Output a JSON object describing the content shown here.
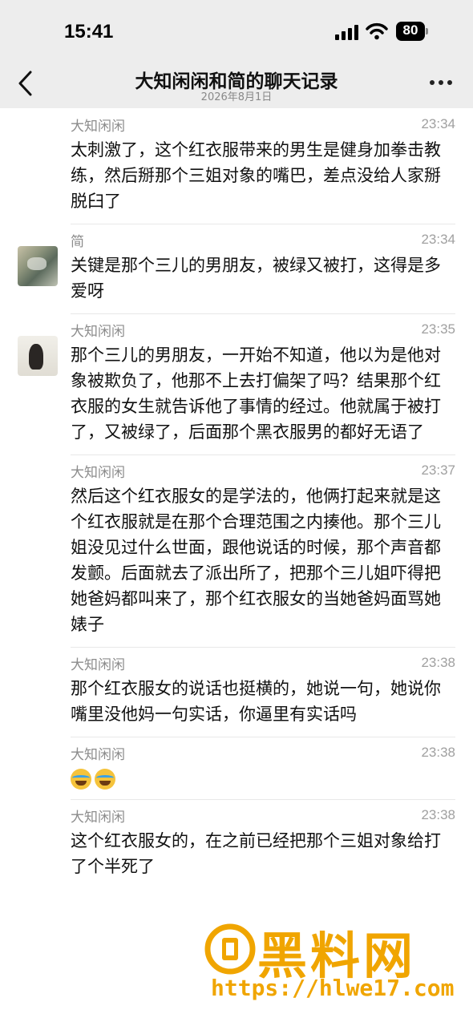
{
  "status_bar": {
    "time": "15:41",
    "battery": "80"
  },
  "nav": {
    "title": "大知闲闲和简的聊天记录",
    "date": "2026年8月1日"
  },
  "messages": [
    {
      "sender": "大知闲闲",
      "time": "23:34",
      "text": "太刺激了，这个红衣服带来的男生是健身加拳击教练，然后掰那个三姐对象的嘴巴，差点没给人家掰脱臼了"
    },
    {
      "sender": "简",
      "time": "23:34",
      "text": "关键是那个三儿的男朋友，被绿又被打，这得是多爱呀"
    },
    {
      "sender": "大知闲闲",
      "time": "23:35",
      "text": "那个三儿的男朋友，一开始不知道，他以为是他对象被欺负了，他那不上去打偏架了吗？结果那个红衣服的女生就告诉他了事情的经过。他就属于被打了，又被绿了，后面那个黑衣服男的都好无语了"
    },
    {
      "sender": "大知闲闲",
      "time": "23:37",
      "text": "然后这个红衣服女的是学法的，他俩打起来就是这个红衣服就是在那个合理范围之内揍他。那个三儿姐没见过什么世面，跟他说话的时候，那个声音都发颤。后面就去了派出所了，把那个三儿姐吓得把她爸妈都叫来了，那个红衣服女的当她爸妈面骂她婊子"
    },
    {
      "sender": "大知闲闲",
      "time": "23:38",
      "text": "那个红衣服女的说话也挺横的，她说一句，她说你嘴里没他妈一句实话，你逼里有实话吗"
    },
    {
      "sender": "大知闲闲",
      "time": "23:38"
    },
    {
      "sender": "大知闲闲",
      "time": "23:38",
      "text": "这个红衣服女的，在之前已经把那个三姐对象给打了个半死了"
    }
  ],
  "watermark": {
    "title": "黑料网",
    "url": "https://hlwe17.com"
  },
  "colors": {
    "nav_bg": "#ededed",
    "watermark": "#f0a500"
  }
}
